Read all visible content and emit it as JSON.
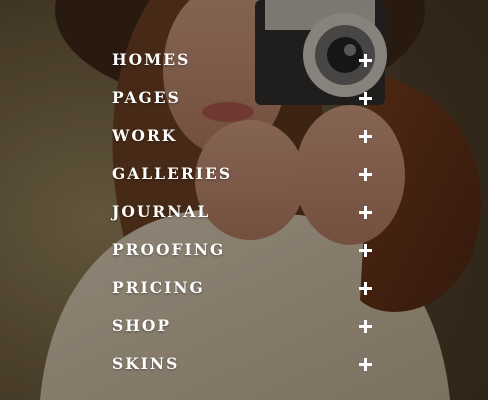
{
  "menu": {
    "items": [
      {
        "label": "HOMES"
      },
      {
        "label": "PAGES"
      },
      {
        "label": "WORK"
      },
      {
        "label": "GALLERIES"
      },
      {
        "label": "JOURNAL"
      },
      {
        "label": "PROOFING"
      },
      {
        "label": "PRICING"
      },
      {
        "label": "SHOP"
      },
      {
        "label": "SKINS"
      }
    ],
    "expand_icon": "plus-icon"
  },
  "colors": {
    "menu_text": "#ffffff",
    "overlay": "#140e08"
  }
}
